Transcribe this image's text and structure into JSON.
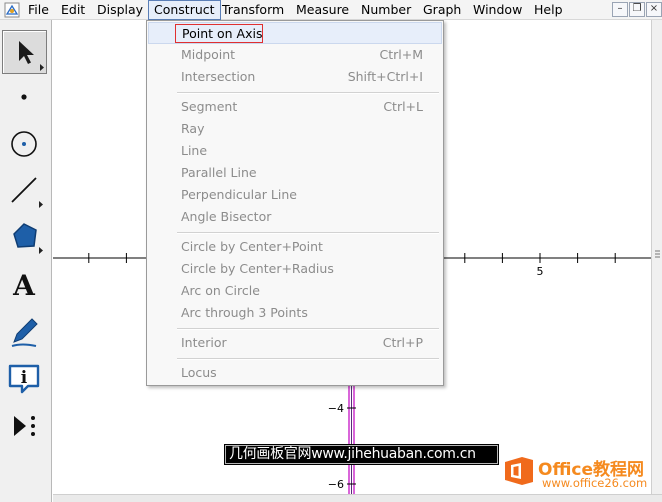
{
  "menubar": {
    "items": [
      {
        "id": "file",
        "label": "File"
      },
      {
        "id": "edit",
        "label": "Edit"
      },
      {
        "id": "display",
        "label": "Display"
      },
      {
        "id": "construct",
        "label": "Construct"
      },
      {
        "id": "transform",
        "label": "Transform"
      },
      {
        "id": "measure",
        "label": "Measure"
      },
      {
        "id": "number",
        "label": "Number"
      },
      {
        "id": "graph",
        "label": "Graph"
      },
      {
        "id": "window",
        "label": "Window"
      },
      {
        "id": "help",
        "label": "Help"
      }
    ],
    "active": "Construct",
    "window_buttons": {
      "minimize": "–",
      "restore": "❐",
      "close": "×"
    }
  },
  "toolbox": {
    "tools": [
      {
        "name": "arrow-tool",
        "icon": "arrow-pointer-icon",
        "selected": true
      },
      {
        "name": "point-tool",
        "icon": "point-icon"
      },
      {
        "name": "compass-tool",
        "icon": "circle-icon"
      },
      {
        "name": "straightedge-tool",
        "icon": "line-segment-icon"
      },
      {
        "name": "polygon-tool",
        "icon": "polygon-icon"
      },
      {
        "name": "text-tool",
        "icon": "text-a-icon",
        "glyph": "A"
      },
      {
        "name": "marker-tool",
        "icon": "pen-marker-icon"
      },
      {
        "name": "information-tool",
        "icon": "info-icon",
        "glyph": "i"
      },
      {
        "name": "custom-tool",
        "icon": "custom-tool-icon"
      }
    ]
  },
  "construct_menu": {
    "items": [
      {
        "label": "Point on Axis",
        "shortcut": "",
        "enabled": true,
        "highlighted": true
      },
      {
        "label": "Midpoint",
        "shortcut": "Ctrl+M",
        "enabled": false
      },
      {
        "label": "Intersection",
        "shortcut": "Shift+Ctrl+I",
        "enabled": false
      },
      {
        "label": "Segment",
        "shortcut": "Ctrl+L",
        "enabled": false
      },
      {
        "label": "Ray",
        "shortcut": "",
        "enabled": false
      },
      {
        "label": "Line",
        "shortcut": "",
        "enabled": false
      },
      {
        "label": "Parallel Line",
        "shortcut": "",
        "enabled": false
      },
      {
        "label": "Perpendicular Line",
        "shortcut": "",
        "enabled": false
      },
      {
        "label": "Angle Bisector",
        "shortcut": "",
        "enabled": false
      },
      {
        "label": "Circle by Center+Point",
        "shortcut": "",
        "enabled": false
      },
      {
        "label": "Circle by Center+Radius",
        "shortcut": "",
        "enabled": false
      },
      {
        "label": "Arc on Circle",
        "shortcut": "",
        "enabled": false
      },
      {
        "label": "Arc through 3 Points",
        "shortcut": "",
        "enabled": false
      },
      {
        "label": "Interior",
        "shortcut": "Ctrl+P",
        "enabled": false
      },
      {
        "label": "Locus",
        "shortcut": "",
        "enabled": false
      }
    ]
  },
  "graph": {
    "x_tick_label": "5",
    "y_tick_labels": [
      "−4",
      "−6"
    ]
  },
  "watermark": {
    "caption": "几何画板官网www.jihehuaban.com.cn",
    "brand": "Office教程网",
    "url": "www.office26.com"
  },
  "colors": {
    "menu_active_border": "#5b7fb7",
    "highlight_box": "#e03030",
    "axis_magenta": "#c000c0",
    "brand_orange": "#f58a1f",
    "tool_blue": "#1e5fa8"
  }
}
